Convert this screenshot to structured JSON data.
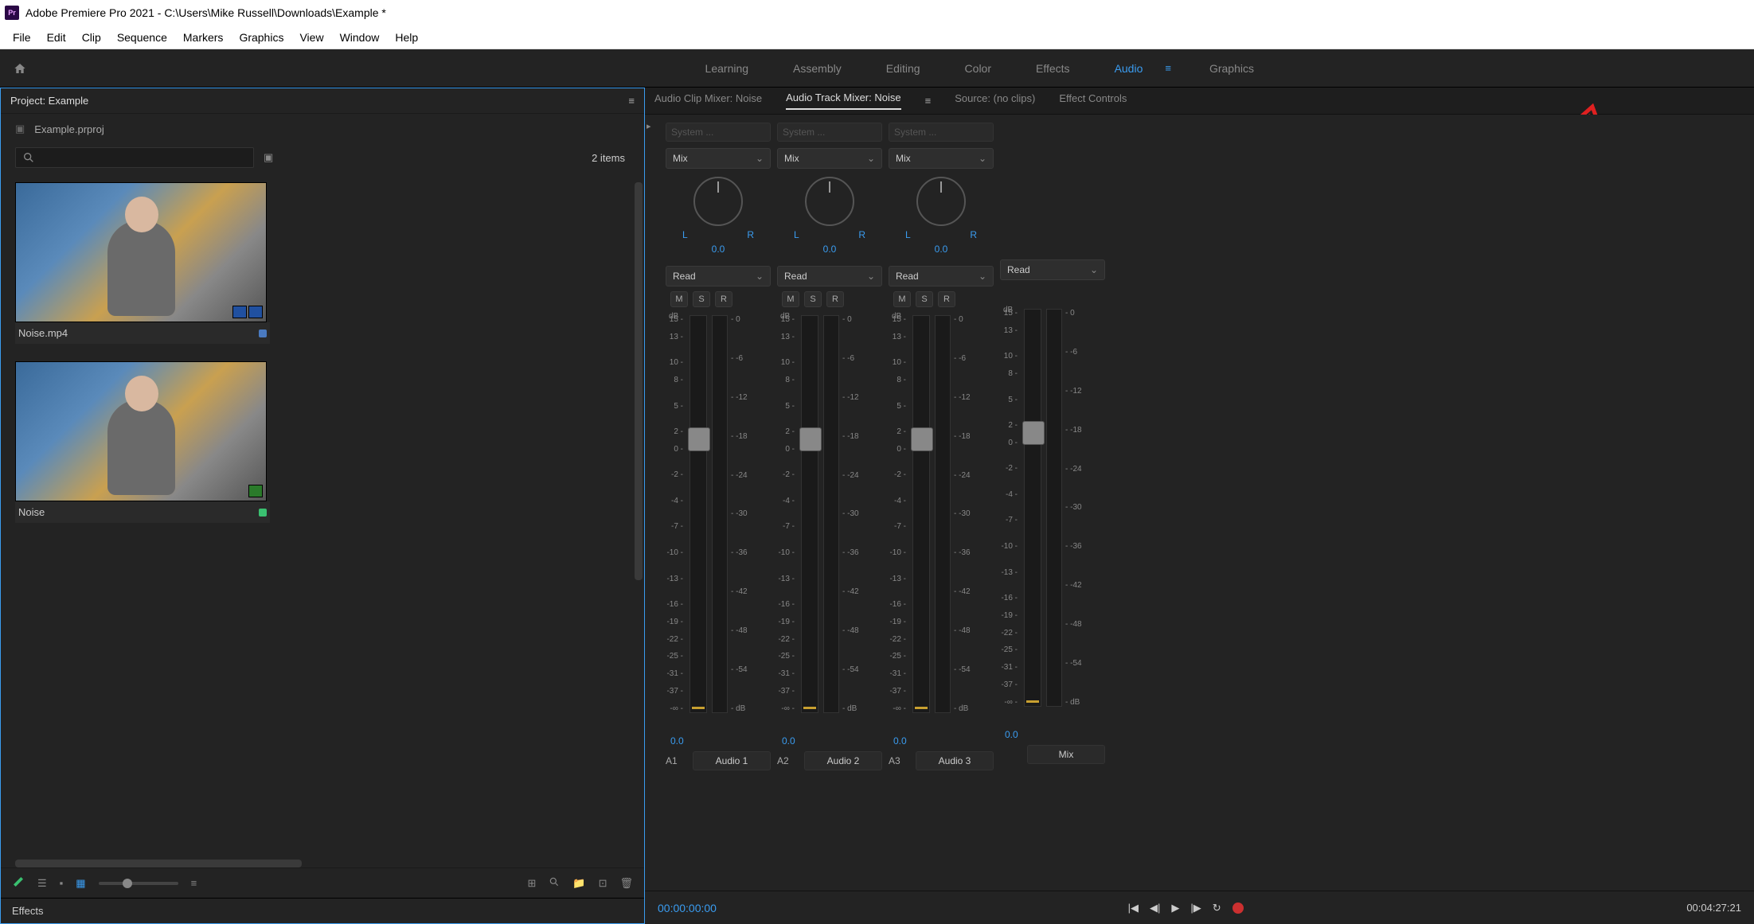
{
  "title": "Adobe Premiere Pro 2021 - C:\\Users\\Mike Russell\\Downloads\\Example *",
  "menubar": [
    "File",
    "Edit",
    "Clip",
    "Sequence",
    "Markers",
    "Graphics",
    "View",
    "Window",
    "Help"
  ],
  "workspaces": [
    "Learning",
    "Assembly",
    "Editing",
    "Color",
    "Effects",
    "Audio",
    "Graphics"
  ],
  "active_workspace": "Audio",
  "project_panel": {
    "title": "Project: Example",
    "file": "Example.prproj",
    "item_count": "2 items",
    "items": [
      {
        "name": "Noise.mp4",
        "dot": "blue"
      },
      {
        "name": "Noise",
        "dot": "green"
      }
    ]
  },
  "effects_panel": {
    "title": "Effects"
  },
  "source_tabs": [
    {
      "label": "Audio Clip Mixer: Noise",
      "active": false
    },
    {
      "label": "Audio Track Mixer: Noise",
      "active": true
    },
    {
      "label": "Source: (no clips)",
      "active": false
    },
    {
      "label": "Effect Controls",
      "active": false
    }
  ],
  "mixer": {
    "system_label": "System ...",
    "mix_label": "Mix",
    "pan_l": "L",
    "pan_r": "R",
    "pan_val": "0.0",
    "auto_label": "Read",
    "m": "M",
    "s": "S",
    "r": "R",
    "db_label": "dB",
    "scale_left": [
      "15 -",
      "13 -",
      "",
      "10 -",
      "8 -",
      "",
      "5 -",
      "",
      "2 -",
      "0 -",
      "",
      "-2 -",
      "",
      "-4 -",
      "",
      "-7 -",
      "",
      "-10 -",
      "",
      "-13 -",
      "",
      "-16 -",
      "-19 -",
      "-22 -",
      "-25 -",
      "-31 -",
      "-37 -",
      "-∞ -"
    ],
    "scale_right": [
      "- 0",
      "",
      "- -6",
      "",
      "- -12",
      "",
      "- -18",
      "",
      "- -24",
      "",
      "- -30",
      "",
      "- -36",
      "",
      "- -42",
      "",
      "- -48",
      "",
      "- -54",
      "",
      "- dB"
    ],
    "gain": "0.0",
    "tracks": [
      {
        "anum": "A1",
        "name": "Audio 1"
      },
      {
        "anum": "A2",
        "name": "Audio 2"
      },
      {
        "anum": "A3",
        "name": "Audio 3"
      }
    ],
    "master": {
      "name": "Mix"
    }
  },
  "transport": {
    "tc_in": "00:00:00:00",
    "tc_out": "00:04:27:21"
  }
}
